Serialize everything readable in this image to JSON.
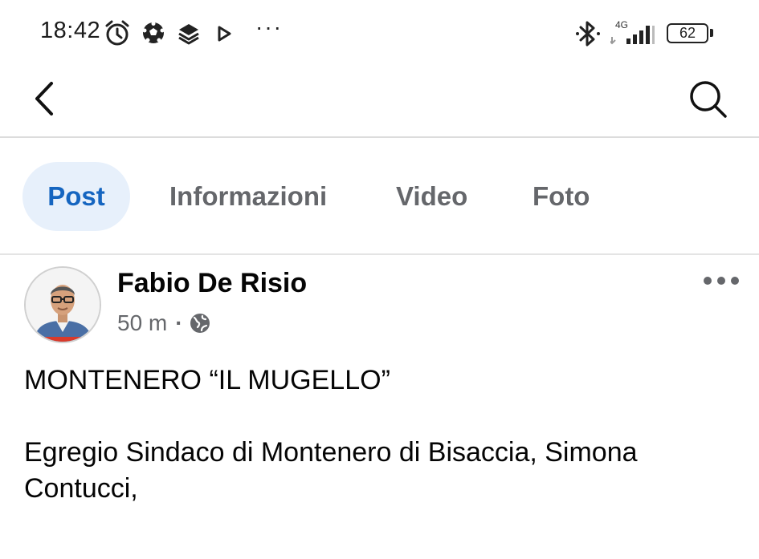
{
  "status_bar": {
    "time": "18:42",
    "icons": [
      "alarm-icon",
      "soccer-ball-icon",
      "layers-icon",
      "play-icon"
    ],
    "overflow": "···",
    "network": "4G",
    "battery": "62"
  },
  "header": {
    "back_icon": "chevron-left-icon",
    "search_icon": "search-icon"
  },
  "tabs": [
    {
      "label": "Post",
      "active": true
    },
    {
      "label": "Informazioni",
      "active": false
    },
    {
      "label": "Video",
      "active": false
    },
    {
      "label": "Foto",
      "active": false
    }
  ],
  "post": {
    "author": "Fabio De Risio",
    "time": "50 m",
    "separator": "·",
    "audience_icon": "globe-icon",
    "menu_icon": "more-horizontal-icon",
    "title": "MONTENERO “IL MUGELLO”",
    "body": "Egregio Sindaco di Montenero di Bisaccia, Simona Contucci,"
  },
  "colors": {
    "accent": "#1565c0",
    "active_tab_bg": "#e7f0fb",
    "secondary_text": "#65676b",
    "divider": "#dcdcdc"
  }
}
